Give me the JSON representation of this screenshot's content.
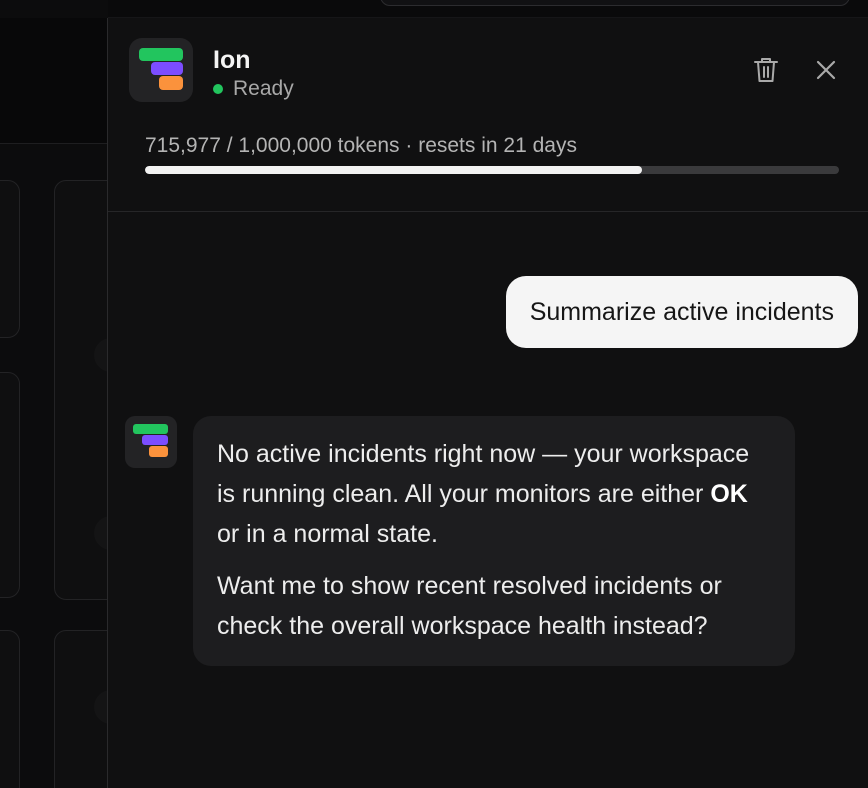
{
  "assistant": {
    "name": "Ion",
    "status": "Ready",
    "status_color": "#22c55e",
    "logo_colors": [
      "#22c55e",
      "#7c4dff",
      "#fb923c"
    ]
  },
  "header": {
    "delete_icon": "trash-icon",
    "close_icon": "close-icon"
  },
  "usage": {
    "text": "715,977 / 1,000,000 tokens · resets in 21 days",
    "used": 715977,
    "limit": 1000000
  },
  "messages": [
    {
      "role": "user",
      "text": "Summarize active incidents"
    },
    {
      "role": "assistant",
      "paragraph1": {
        "before": "No active incidents right now — your workspace is running clean. All your monitors are either ",
        "bold": "OK",
        "after": " or in a normal state."
      },
      "paragraph2": "Want me to show recent resolved incidents or check the overall workspace health instead?"
    }
  ]
}
